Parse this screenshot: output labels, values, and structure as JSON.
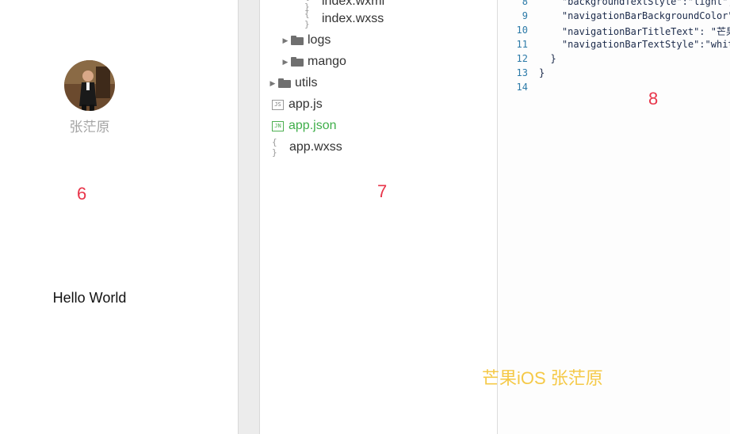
{
  "simulator": {
    "nickname": "张茫原",
    "greeting": "Hello World",
    "region_number": "6"
  },
  "file_tree": {
    "region_number": "7",
    "items": [
      {
        "name": "index.wxml",
        "type": "wxml"
      },
      {
        "name": "index.wxss",
        "type": "wxss"
      },
      {
        "name": "logs",
        "type": "folder",
        "collapsed": true
      },
      {
        "name": "mango",
        "type": "folder",
        "collapsed": true
      },
      {
        "name": "utils",
        "type": "folder",
        "collapsed": true
      },
      {
        "name": "app.js",
        "type": "js",
        "icon": "JS"
      },
      {
        "name": "app.json",
        "type": "json",
        "icon": "JN",
        "selected": true
      },
      {
        "name": "app.wxss",
        "type": "wxss"
      }
    ],
    "brace_icon": "{ }",
    "selected_color": "#3fae4a"
  },
  "editor": {
    "region_number": "8",
    "lines": [
      {
        "num": "8",
        "code": "    \"backgroundTextStyle\":\"light\","
      },
      {
        "num": "9",
        "code": "    \"navigationBarBackgroundColor\": \"#fff\","
      },
      {
        "num": "10",
        "code": "    \"navigationBarTitleText\": \"芒果iOS\","
      },
      {
        "num": "11",
        "code": "    \"navigationBarTextStyle\":\"white\""
      },
      {
        "num": "12",
        "code": "  }"
      },
      {
        "num": "13",
        "code": "}"
      },
      {
        "num": "14",
        "code": ""
      }
    ]
  },
  "watermark": "芒果iOS 张茫原",
  "colors": {
    "annotation_red": "#e8354a",
    "watermark_yellow": "#f5c947",
    "line_number_blue": "#2c7aa8"
  }
}
